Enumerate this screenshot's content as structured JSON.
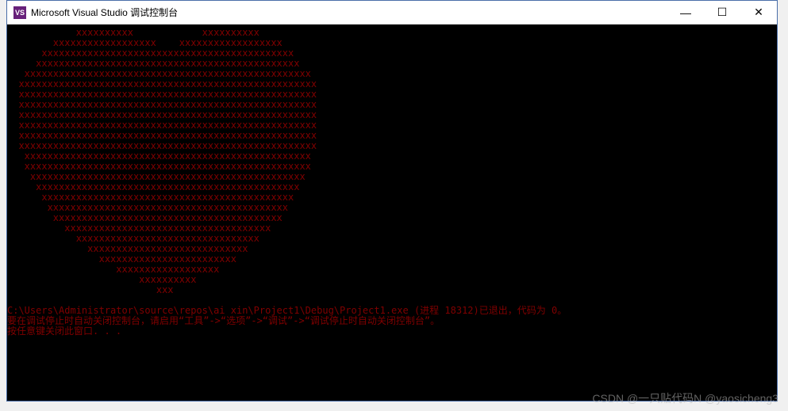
{
  "window": {
    "icon_label": "VS",
    "title": "Microsoft Visual Studio 调试控制台",
    "minimize": "—",
    "maximize": "☐",
    "close": "✕"
  },
  "heart": [
    "            xxxxxxxxxx            xxxxxxxxxx",
    "        xxxxxxxxxxxxxxxxxx    xxxxxxxxxxxxxxxxxx",
    "      xxxxxxxxxxxxxxxxxxxxxxxxxxxxxxxxxxxxxxxxxxxx",
    "     xxxxxxxxxxxxxxxxxxxxxxxxxxxxxxxxxxxxxxxxxxxxxx",
    "   xxxxxxxxxxxxxxxxxxxxxxxxxxxxxxxxxxxxxxxxxxxxxxxxxx",
    "  xxxxxxxxxxxxxxxxxxxxxxxxxxxxxxxxxxxxxxxxxxxxxxxxxxxx",
    "  xxxxxxxxxxxxxxxxxxxxxxxxxxxxxxxxxxxxxxxxxxxxxxxxxxxx",
    "  xxxxxxxxxxxxxxxxxxxxxxxxxxxxxxxxxxxxxxxxxxxxxxxxxxxx",
    "  xxxxxxxxxxxxxxxxxxxxxxxxxxxxxxxxxxxxxxxxxxxxxxxxxxxx",
    "  xxxxxxxxxxxxxxxxxxxxxxxxxxxxxxxxxxxxxxxxxxxxxxxxxxxx",
    "  xxxxxxxxxxxxxxxxxxxxxxxxxxxxxxxxxxxxxxxxxxxxxxxxxxxx",
    "  xxxxxxxxxxxxxxxxxxxxxxxxxxxxxxxxxxxxxxxxxxxxxxxxxxxx",
    "   xxxxxxxxxxxxxxxxxxxxxxxxxxxxxxxxxxxxxxxxxxxxxxxxxx",
    "   xxxxxxxxxxxxxxxxxxxxxxxxxxxxxxxxxxxxxxxxxxxxxxxxxx",
    "    xxxxxxxxxxxxxxxxxxxxxxxxxxxxxxxxxxxxxxxxxxxxxxxx",
    "     xxxxxxxxxxxxxxxxxxxxxxxxxxxxxxxxxxxxxxxxxxxxxx",
    "      xxxxxxxxxxxxxxxxxxxxxxxxxxxxxxxxxxxxxxxxxxxx",
    "       xxxxxxxxxxxxxxxxxxxxxxxxxxxxxxxxxxxxxxxxxx",
    "        xxxxxxxxxxxxxxxxxxxxxxxxxxxxxxxxxxxxxxxx",
    "          xxxxxxxxxxxxxxxxxxxxxxxxxxxxxxxxxxxx",
    "            xxxxxxxxxxxxxxxxxxxxxxxxxxxxxxxx",
    "              xxxxxxxxxxxxxxxxxxxxxxxxxxxx",
    "                xxxxxxxxxxxxxxxxxxxxxxxx",
    "                   xxxxxxxxxxxxxxxxxx",
    "                       xxxxxxxxxx",
    "                          xxx"
  ],
  "messages": [
    "",
    "C:\\Users\\Administrator\\source\\repos\\ai xin\\Project1\\Debug\\Project1.exe (进程 18312)已退出，代码为 0。",
    "要在调试停止时自动关闭控制台，请启用“工具”->“选项”->“调试”->“调试停止时自动关闭控制台”。",
    "按任意键关闭此窗口. . ."
  ],
  "watermark": "CSDN @一只贴代码N @yaosicheng3"
}
